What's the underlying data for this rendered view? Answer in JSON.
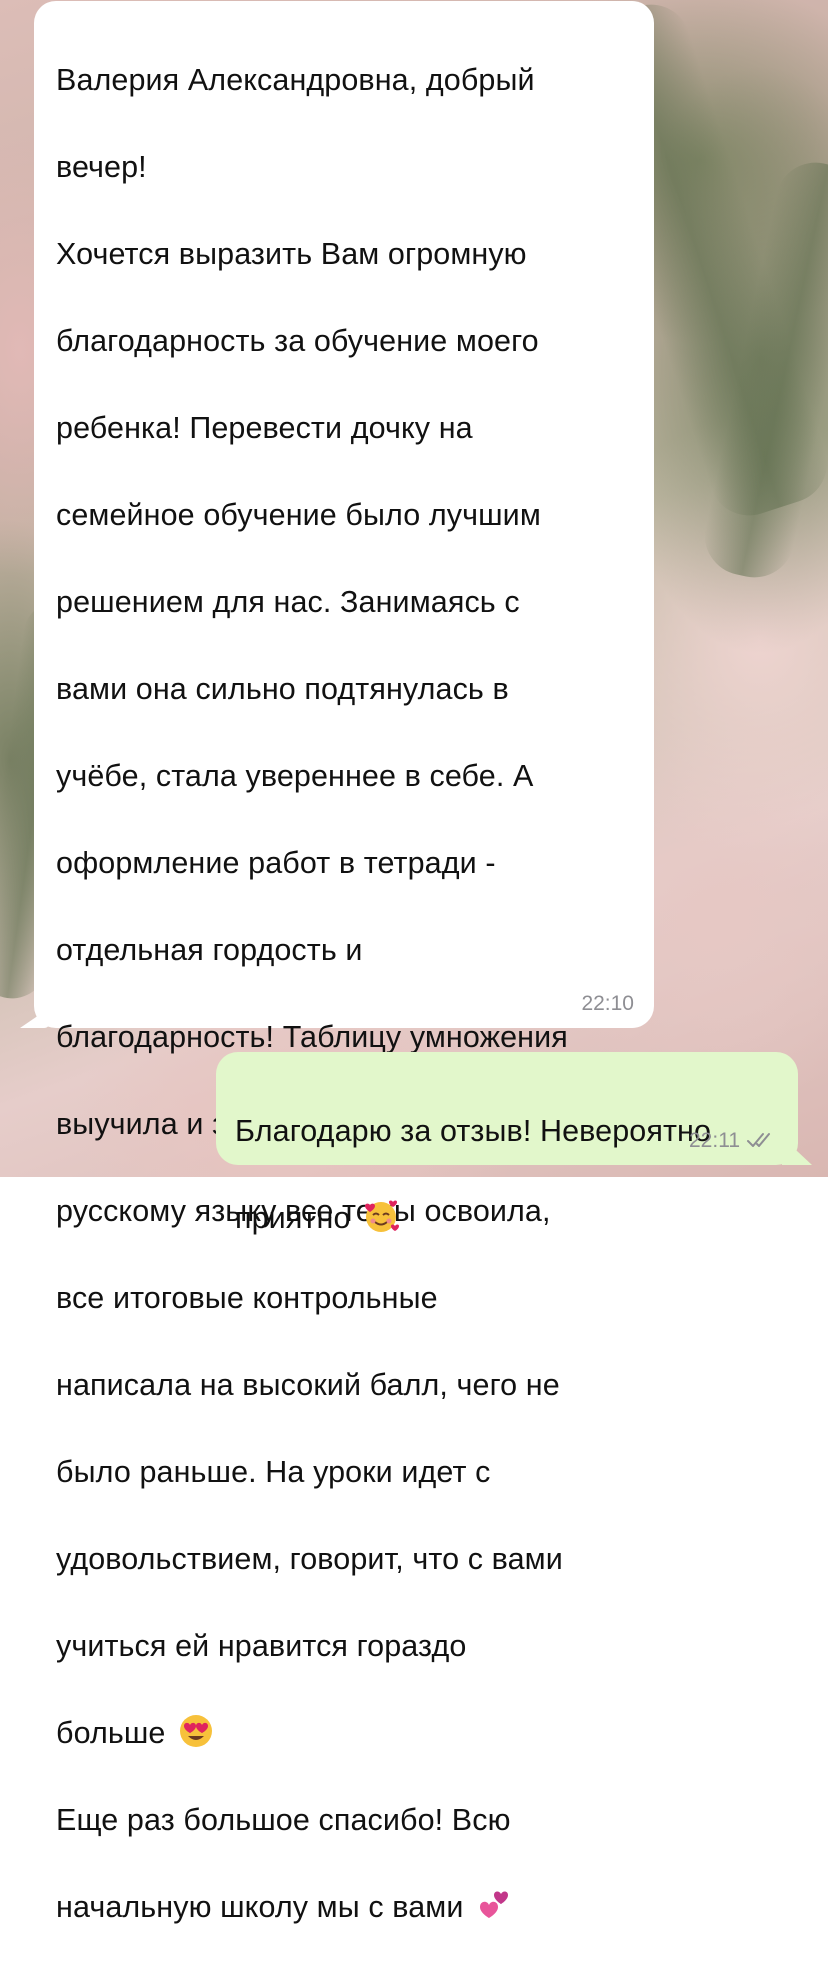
{
  "chat": {
    "incoming": {
      "lines": [
        "Валерия Александровна, добрый",
        "вечер!",
        "Хочется выразить Вам огромную",
        "благодарность за обучение моего",
        "ребенка! Перевести дочку на",
        "семейное обучение было лучшим",
        "решением для нас. Занимаясь с",
        "вами она сильно подтянулась в",
        "учёбе, стала увереннее в себе. А",
        "оформление работ в тетради -",
        "отдельная гордость и",
        "благодарность! Таблицу умножения",
        "выучила и запомнила на ура, по",
        "русскому языку все темы освоила,",
        "все итоговые контрольные",
        "написала на высокий балл, чего не",
        "было раньше. На уроки идет с",
        "удовольствием, говорит, что с вами",
        "учиться ей нравится гораздо",
        "больше",
        "Еще раз большое спасибо! Всю",
        "начальную школу мы с вами"
      ],
      "emoji_after_line_20": "heart-eyes-emoji",
      "emoji_after_line_22": "two-hearts-emoji",
      "time": "22:10"
    },
    "outgoing": {
      "lines": [
        "Благодарю за отзыв! Невероятно",
        "приятно"
      ],
      "emoji_after_line_2": "smiling-face-with-hearts-emoji",
      "time": "22:11",
      "status_icon": "double-check-read-icon"
    }
  },
  "colors": {
    "incoming_bubble": "#ffffff",
    "outgoing_bubble": "#e2f7cb",
    "timestamp": "#8e8e93",
    "text": "#111111"
  }
}
